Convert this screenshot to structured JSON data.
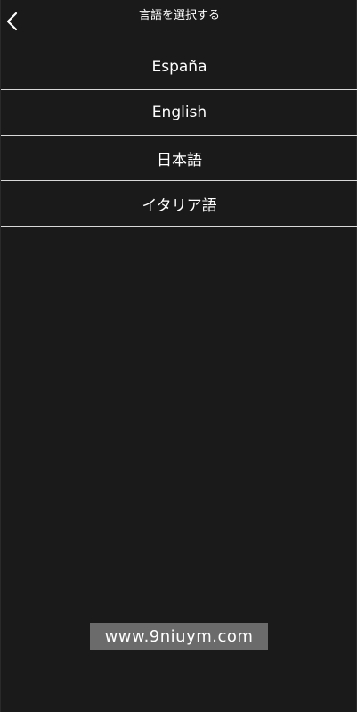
{
  "header": {
    "back_icon": "chevron-left-icon",
    "title": "言語を選択する"
  },
  "languages": [
    {
      "label": "España"
    },
    {
      "label": "English"
    },
    {
      "label": "日本語"
    },
    {
      "label": "イタリア語"
    }
  ],
  "watermark": {
    "text": "www.9niuym.com"
  },
  "colors": {
    "background": "#1a1a1a",
    "text": "#ffffff",
    "divider": "#d8d8d8",
    "watermark_bg": "#6b6b6b"
  }
}
